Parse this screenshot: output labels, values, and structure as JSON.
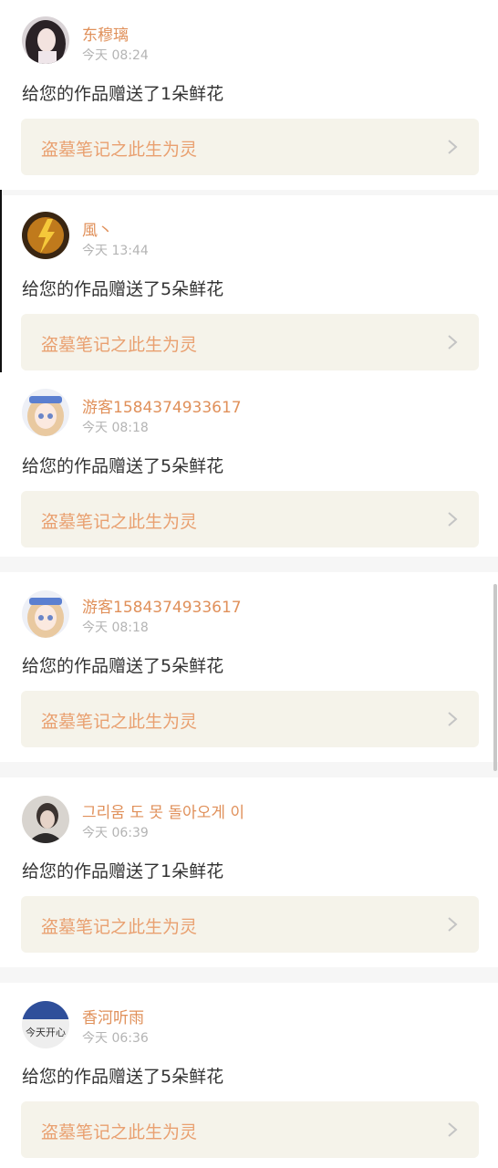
{
  "notifications": [
    {
      "name": "东穆璃",
      "time": "今天 08:24",
      "message": "给您的作品赠送了1朵鲜花",
      "work_title": "盗墓笔记之此生为灵",
      "avatar_icon": "user-avatar-girl-dark-hair"
    },
    {
      "name": "風丶",
      "time": "今天 13:44",
      "message": "给您的作品赠送了5朵鲜花",
      "work_title": "盗墓笔记之此生为灵",
      "avatar_icon": "user-avatar-lightning-mascot"
    },
    {
      "name": "游客1584374933617",
      "time": "今天 08:18",
      "message": "给您的作品赠送了5朵鲜花",
      "work_title": "盗墓笔记之此生为灵",
      "avatar_icon": "user-avatar-anime-girl"
    },
    {
      "name": "游客1584374933617",
      "time": "今天 08:18",
      "message": "给您的作品赠送了5朵鲜花",
      "work_title": "盗墓笔记之此生为灵",
      "avatar_icon": "user-avatar-anime-girl"
    },
    {
      "name": "그리움 도 못 돌아오게 이",
      "time": "今天 06:39",
      "message": "给您的作品赠送了1朵鲜花",
      "work_title": "盗墓笔记之此生为灵",
      "avatar_icon": "user-avatar-person-photo"
    },
    {
      "name": "香河听雨",
      "time": "今天 06:36",
      "message": "给您的作品赠送了5朵鲜花",
      "work_title": "盗墓笔记之此生为灵",
      "avatar_icon": "user-avatar-text-image"
    }
  ],
  "avatar_text": "今天开心",
  "colors": {
    "name": "#e0905a",
    "work_title": "#e9a070",
    "work_bg": "#f5f3ea",
    "separator": "#f6f6f6"
  }
}
